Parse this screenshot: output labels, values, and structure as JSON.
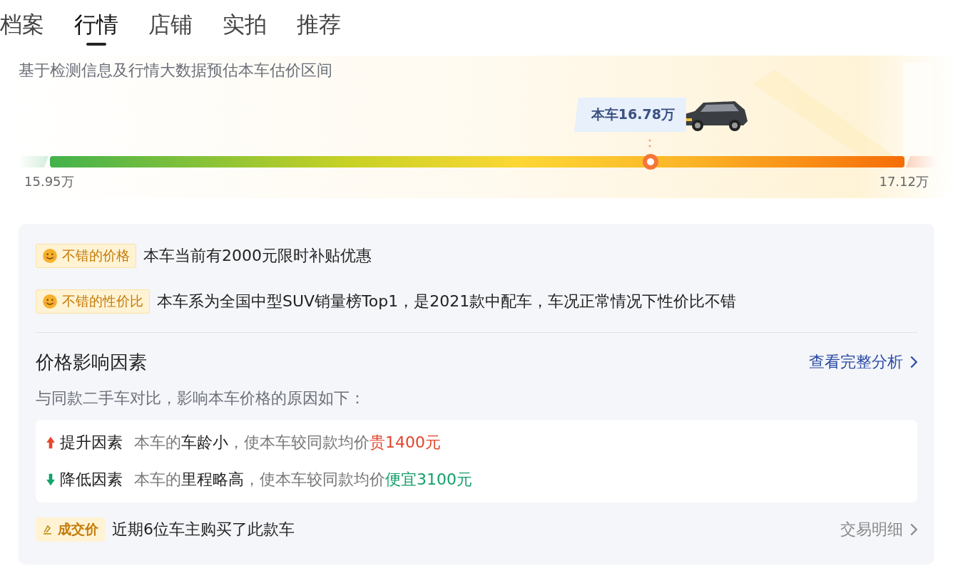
{
  "tabs": [
    {
      "label": "档案",
      "selected": false
    },
    {
      "label": "行情",
      "selected": true
    },
    {
      "label": "店铺",
      "selected": false
    },
    {
      "label": "实拍",
      "selected": false
    },
    {
      "label": "推荐",
      "selected": false
    }
  ],
  "estimate": {
    "subtitle": "基于检测信息及行情大数据预估本车估价区间",
    "marker_label": "本车16.78万",
    "level": 0.703,
    "min_label": "15.95万",
    "max_label": "17.12万"
  },
  "highlights": [
    {
      "kind": "smile",
      "tag": "不错的价格",
      "text": "本车当前有2000元限时补贴优惠"
    },
    {
      "kind": "smile",
      "tag": "不错的性价比",
      "text": "本车系为全国中型SUV销量榜Top1，是2021款中配车，车况正常情况下性价比不错"
    }
  ],
  "factors": {
    "title": "价格影响因素",
    "link": "查看完整分析",
    "intro": "与同款二手车对比，影响本车价格的原因如下：",
    "items": [
      {
        "kind": "up",
        "label": "提升因素",
        "pre": "本车的",
        "key": "车龄小",
        "mid": "，使本车较同款均价",
        "amount": "贵1400元"
      },
      {
        "kind": "down",
        "label": "降低因素",
        "pre": "本车的",
        "key": "里程略高",
        "mid": "，使本车较同款均价",
        "amount": "便宜3100元"
      }
    ]
  },
  "deals": {
    "kind": "deal",
    "tag": "成交价",
    "text": "近期6位车主购买了此款车",
    "link": "交易明细"
  }
}
